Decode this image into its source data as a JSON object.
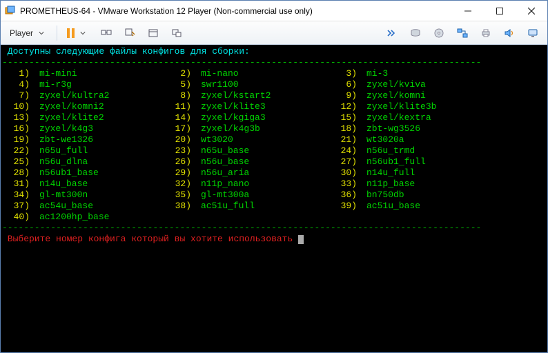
{
  "window": {
    "title": "PROMETHEUS-64 - VMware Workstation 12 Player (Non-commercial use only)"
  },
  "toolbar": {
    "player_label": "Player"
  },
  "terminal": {
    "header": "Доступны следующие файлы конфигов для сборки:",
    "dashes": "-----------------------------------------------------------------------------------------",
    "configs": [
      [
        {
          "n": "1",
          "name": "mi-mini"
        },
        {
          "n": "2",
          "name": "mi-nano"
        },
        {
          "n": "3",
          "name": "mi-3"
        }
      ],
      [
        {
          "n": "4",
          "name": "mi-r3g"
        },
        {
          "n": "5",
          "name": "swr1100"
        },
        {
          "n": "6",
          "name": "zyxel/kviva"
        }
      ],
      [
        {
          "n": "7",
          "name": "zyxel/kultra2"
        },
        {
          "n": "8",
          "name": "zyxel/kstart2"
        },
        {
          "n": "9",
          "name": "zyxel/komni"
        }
      ],
      [
        {
          "n": "10",
          "name": "zyxel/komni2"
        },
        {
          "n": "11",
          "name": "zyxel/klite3"
        },
        {
          "n": "12",
          "name": "zyxel/klite3b"
        }
      ],
      [
        {
          "n": "13",
          "name": "zyxel/klite2"
        },
        {
          "n": "14",
          "name": "zyxel/kgiga3"
        },
        {
          "n": "15",
          "name": "zyxel/kextra"
        }
      ],
      [
        {
          "n": "16",
          "name": "zyxel/k4g3"
        },
        {
          "n": "17",
          "name": "zyxel/k4g3b"
        },
        {
          "n": "18",
          "name": "zbt-wg3526"
        }
      ],
      [
        {
          "n": "19",
          "name": "zbt-we1326"
        },
        {
          "n": "20",
          "name": "wt3020"
        },
        {
          "n": "21",
          "name": "wt3020a"
        }
      ],
      [
        {
          "n": "22",
          "name": "n65u_full"
        },
        {
          "n": "23",
          "name": "n65u_base"
        },
        {
          "n": "24",
          "name": "n56u_trmd"
        }
      ],
      [
        {
          "n": "25",
          "name": "n56u_dlna"
        },
        {
          "n": "26",
          "name": "n56u_base"
        },
        {
          "n": "27",
          "name": "n56ub1_full"
        }
      ],
      [
        {
          "n": "28",
          "name": "n56ub1_base"
        },
        {
          "n": "29",
          "name": "n56u_aria"
        },
        {
          "n": "30",
          "name": "n14u_full"
        }
      ],
      [
        {
          "n": "31",
          "name": "n14u_base"
        },
        {
          "n": "32",
          "name": "n11p_nano"
        },
        {
          "n": "33",
          "name": "n11p_base"
        }
      ],
      [
        {
          "n": "34",
          "name": "gl-mt300n"
        },
        {
          "n": "35",
          "name": "gl-mt300a"
        },
        {
          "n": "36",
          "name": "bn750db"
        }
      ],
      [
        {
          "n": "37",
          "name": "ac54u_base"
        },
        {
          "n": "38",
          "name": "ac51u_full"
        },
        {
          "n": "39",
          "name": "ac51u_base"
        }
      ],
      [
        {
          "n": "40",
          "name": "ac1200hp_base"
        }
      ]
    ],
    "prompt": "Выберите номер конфига который вы хотите использовать"
  }
}
